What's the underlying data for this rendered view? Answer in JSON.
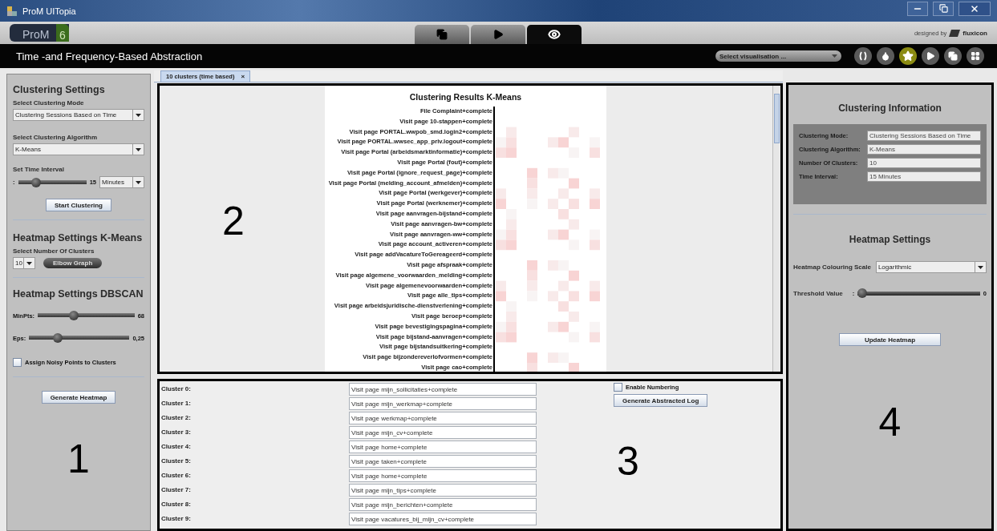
{
  "window": {
    "title": "ProM UITopia"
  },
  "app_bar": {
    "logo": "ProM",
    "logo_version": "6",
    "tabs": [
      {
        "kind": "copy",
        "selected": false
      },
      {
        "kind": "play",
        "selected": false
      },
      {
        "kind": "eye",
        "selected": true
      }
    ],
    "credit_prefix": "designed by",
    "credit_brand": "fluxicon"
  },
  "header": {
    "title": "Time -and Frequency-Based Abstraction",
    "visualisation_select": "Select visualisation ...",
    "actions": [
      {
        "kind": "braces",
        "selected": false
      },
      {
        "kind": "drop",
        "selected": false
      },
      {
        "kind": "star",
        "selected": true
      },
      {
        "kind": "play",
        "selected": false
      },
      {
        "kind": "copy",
        "selected": false
      },
      {
        "kind": "grid",
        "selected": false
      }
    ]
  },
  "left_panel": {
    "clustering_heading": "Clustering Settings",
    "mode_label": "Select Clustering Mode",
    "mode_value": "Clustering Sessions Based on Time",
    "algorithm_label": "Select Clustering Algorithm",
    "algorithm_value": "K-Means",
    "interval_label": "Set Time Interval",
    "interval_prefix": ":",
    "interval": {
      "level": 0.23,
      "reading": "15"
    },
    "interval_unit": "Minutes",
    "start_button": "Start Clustering",
    "kmeans_heading": "Heatmap Settings K-Means",
    "clusters_label": "Select Number Of Clusters",
    "clusters_value": "10",
    "elbow_button": "Elbow Graph",
    "dbscan_heading": "Heatmap Settings DBSCAN",
    "sliders": [
      {
        "label": "MinPts:",
        "level": 0.36,
        "reading": "68"
      },
      {
        "label": "Eps:",
        "level": 0.26,
        "reading": "0,25"
      }
    ],
    "noisy_checkbox": {
      "label": "Assign Noisy Points to Clusters",
      "checked": false
    },
    "generate_button": "Generate Heatmap",
    "annotation": "1"
  },
  "document_tab": {
    "label": "10 clusters (time based)",
    "close": "×"
  },
  "results_panel": {
    "annotation": "2",
    "chart_title": "Clustering Results K-Means",
    "rows": [
      "File Complaint+complete",
      "Visit page 10-stappen+complete",
      "Visit page PORTAL.wwpob_smd.login2+complete",
      "Visit page PORTAL.wwsec_app_priv.logout+complete",
      "Visit page Portal (arbeidsmarktinformatie)+complete",
      "Visit page Portal (fout)+complete",
      "Visit page Portal (ignore_request_page)+complete",
      "Visit page Portal (melding_account_afmelden)+complete",
      "Visit page Portal (werkgever)+complete",
      "Visit page Portal (werknemer)+complete",
      "Visit page aanvragen-bijstand+complete",
      "Visit page aanvragen-bw+complete",
      "Visit page aanvragen-ww+complete",
      "Visit page account_activeren+complete",
      "Visit page addVacatureToGereageerd+complete",
      "Visit page afspraak+complete",
      "Visit page algemene_voorwaarden_melding+complete",
      "Visit page algemenevoorwaarden+complete",
      "Visit page alle_tips+complete",
      "Visit page arbeidsjuridische-dienstverlening+complete",
      "Visit page beroep+complete",
      "Visit page bevestigingspagina+complete",
      "Visit page bijstand-aanvragen+complete",
      "Visit page bijstandsuitkering+complete",
      "Visit page bijzondereverlofvormen+complete",
      "Visit page cao+complete"
    ]
  },
  "clusters_panel": {
    "annotation": "3",
    "clusters": [
      {
        "label": "Cluster 0:",
        "value": "Visit page mijn_sollicitaties+complete"
      },
      {
        "label": "Cluster 1:",
        "value": "Visit page mijn_werkmap+complete"
      },
      {
        "label": "Cluster 2:",
        "value": "Visit page werkmap+complete"
      },
      {
        "label": "Cluster 3:",
        "value": "Visit page mijn_cv+complete"
      },
      {
        "label": "Cluster 4:",
        "value": "Visit page home+complete"
      },
      {
        "label": "Cluster 5:",
        "value": "Visit page taken+complete"
      },
      {
        "label": "Cluster 6:",
        "value": "Visit page home+complete"
      },
      {
        "label": "Cluster 7:",
        "value": "Visit page mijn_tips+complete"
      },
      {
        "label": "Cluster 8:",
        "value": "Visit page mijn_berichten+complete"
      },
      {
        "label": "Cluster 9:",
        "value": "Visit page vacatures_bij_mijn_cv+complete"
      }
    ],
    "numbering_checkbox": {
      "label": "Enable Numbering",
      "checked": false
    },
    "generate_button": "Generate Abstracted Log"
  },
  "info_panel": {
    "annotation": "4",
    "heading": "Clustering Information",
    "fields": [
      {
        "label": "Clustering Mode:",
        "value": "Clustering Sessions Based on Time"
      },
      {
        "label": "Clustering Algorithm:",
        "value": "K-Means"
      },
      {
        "label": "Number Of Clusters:",
        "value": "10"
      },
      {
        "label": "Time Interval:",
        "value": "15 Minutes"
      }
    ],
    "heatmap_heading": "Heatmap Settings",
    "scale_label": "Heatmap Colouring Scale",
    "scale_value": "Logarithmic",
    "threshold_label": "Threshold Value",
    "threshold_prefix": ":",
    "threshold": {
      "level": 0,
      "reading": "0"
    },
    "update_button": "Update Heatmap"
  }
}
